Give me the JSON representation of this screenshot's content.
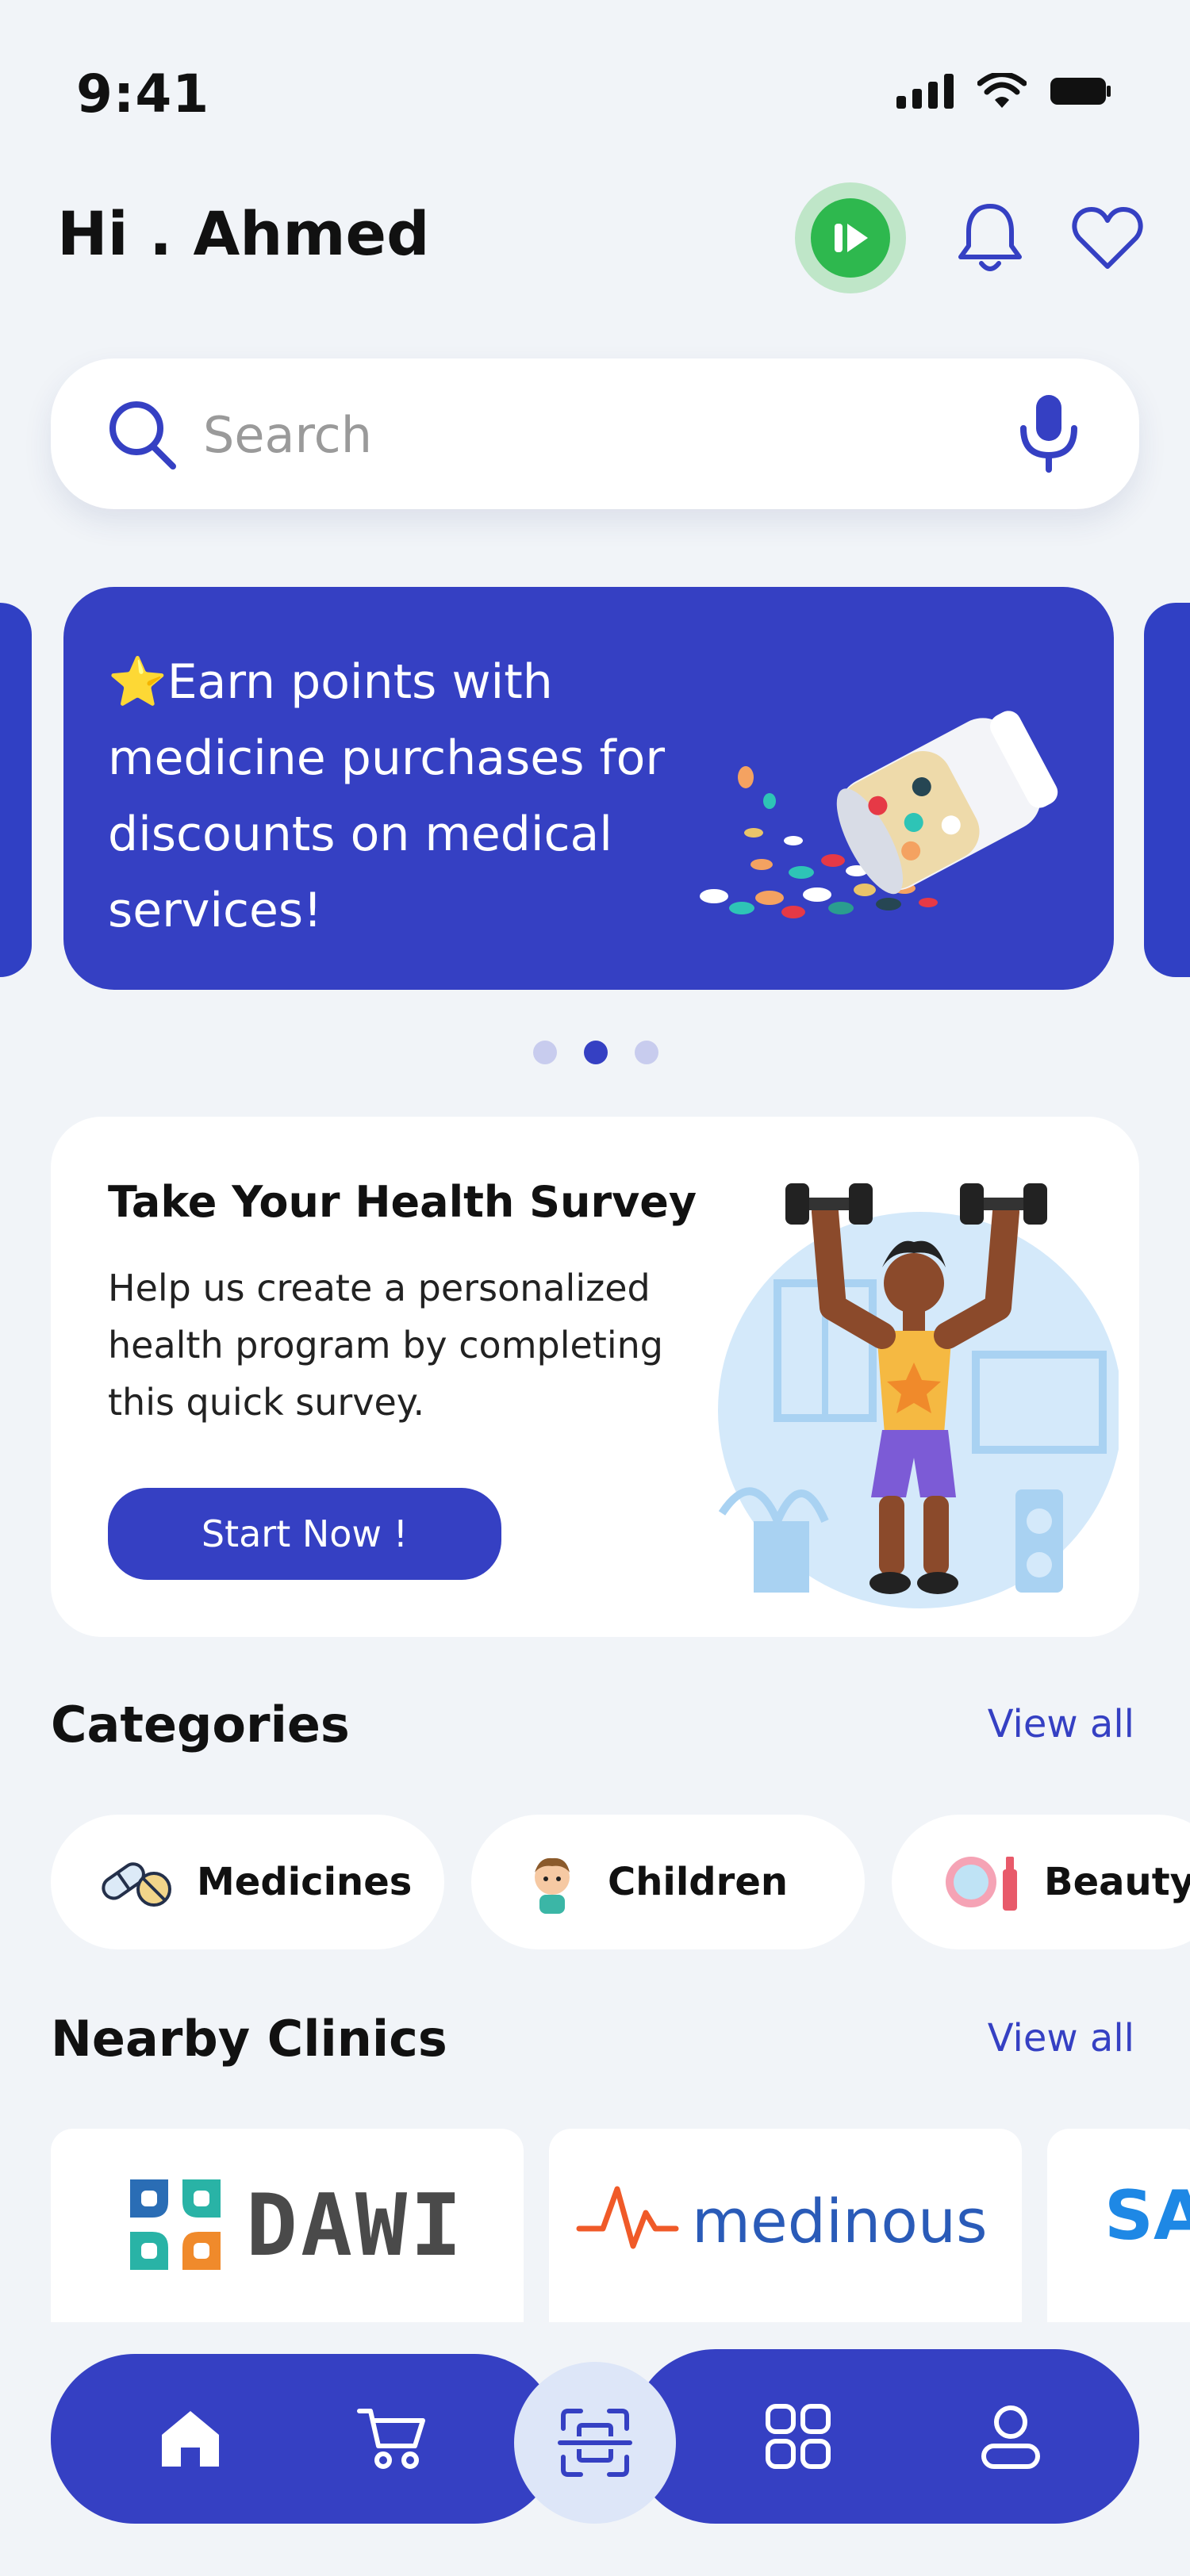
{
  "status_bar": {
    "time": "9:41"
  },
  "header": {
    "greeting": "Hi . Ahmed"
  },
  "search": {
    "placeholder": "Search"
  },
  "banner": {
    "text": "Earn points with medicine purchases for discounts on medical services!",
    "star": "⭐"
  },
  "carousel": {
    "total_pages": 3,
    "active_page": 2
  },
  "survey": {
    "title": "Take Your Health Survey",
    "description": "Help us create a personalized health program by completing this quick survey.",
    "button": "Start Now !"
  },
  "categories": {
    "title": "Categories",
    "view_all": "View all",
    "items": [
      {
        "label": "Medicines",
        "icon": "pills-icon"
      },
      {
        "label": "Children",
        "icon": "child-icon"
      },
      {
        "label": "Beauty",
        "icon": "beauty-icon"
      }
    ]
  },
  "clinics": {
    "title": "Nearby Clinics",
    "view_all": "View all",
    "items": [
      {
        "name": "DAWI"
      },
      {
        "name": "medinous"
      },
      {
        "name": "SA"
      }
    ]
  },
  "bottom_nav": {
    "items": [
      "home-icon",
      "cart-icon",
      "scan-icon",
      "grid-icon",
      "profile-icon"
    ],
    "active": "home-icon"
  },
  "colors": {
    "primary": "#3540C3",
    "background": "#F1F4F8",
    "accent_green": "#2EB84E"
  }
}
